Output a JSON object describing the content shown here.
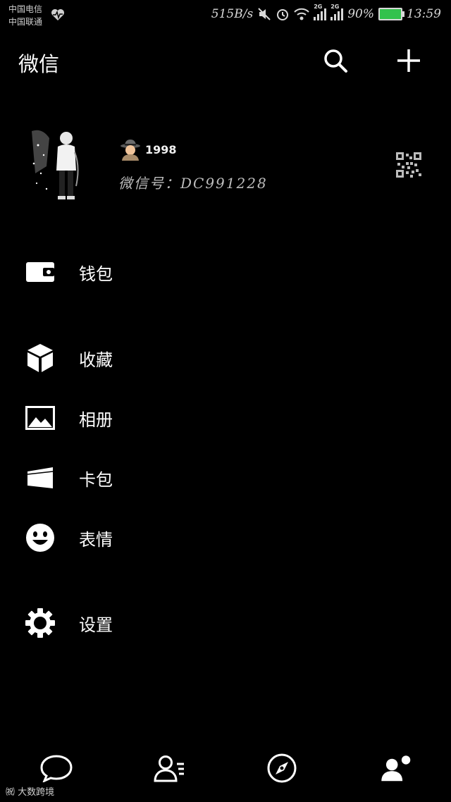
{
  "status_bar": {
    "carrier1": "中国电信",
    "carrier2": "中国联通",
    "speed": "515B/s",
    "sim1_type": "2G",
    "sim2_type": "2G",
    "battery": "90%",
    "time": "13:59"
  },
  "header": {
    "title": "微信",
    "search_icon": "search-icon",
    "add_icon": "plus-icon"
  },
  "profile": {
    "nickname": "1998",
    "wechat_id": "微信号：DC991228"
  },
  "menu": [
    {
      "label": "钱包",
      "icon": "wallet-icon"
    },
    {
      "label": "收藏",
      "icon": "cube-icon"
    },
    {
      "label": "相册",
      "icon": "photo-icon"
    },
    {
      "label": "卡包",
      "icon": "card-icon"
    },
    {
      "label": "表情",
      "icon": "smiley-icon"
    },
    {
      "label": "设置",
      "icon": "gear-icon"
    }
  ],
  "tabs": [
    "chat-icon",
    "contacts-icon",
    "discover-icon",
    "me-icon"
  ],
  "watermark": "大数跨境",
  "colors": {
    "background": "#000000",
    "foreground": "#ffffff",
    "battery": "#33c24d"
  }
}
